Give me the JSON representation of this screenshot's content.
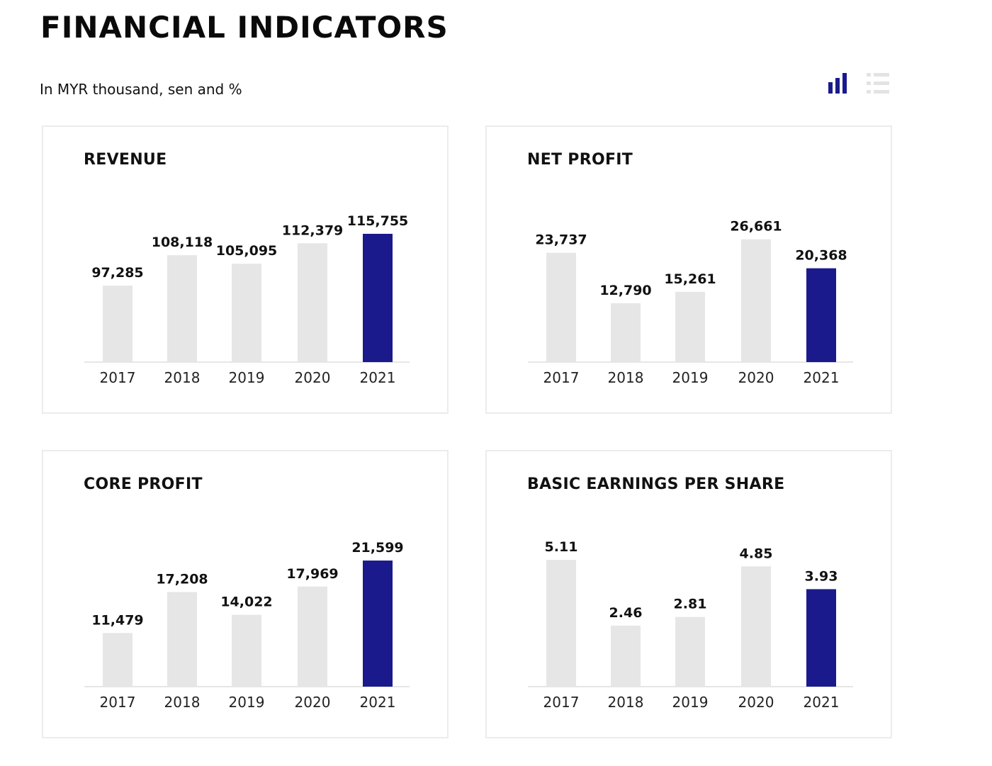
{
  "header": {
    "title": "FINANCIAL INDICATORS",
    "subtitle": "In MYR thousand, sen and %"
  },
  "view_toggle": {
    "chart_icon": "bar-chart-icon",
    "list_icon": "list-icon",
    "active": "chart"
  },
  "colors": {
    "highlight": "#1a1a8c",
    "bar": "#e6e6e6",
    "axis": "#dddddd",
    "inactive_icon": "#e3e3e3"
  },
  "chart_data": [
    {
      "type": "bar",
      "title": "REVENUE",
      "categories": [
        "2017",
        "2018",
        "2019",
        "2020",
        "2021"
      ],
      "values": [
        97285,
        108118,
        105095,
        112379,
        115755
      ],
      "labels": [
        "97,285",
        "108,118",
        "105,095",
        "112,379",
        "115,755"
      ],
      "highlight_index": 4,
      "ylim": [
        70000,
        116000
      ]
    },
    {
      "type": "bar",
      "title": "NET PROFIT",
      "categories": [
        "2017",
        "2018",
        "2019",
        "2020",
        "2021"
      ],
      "values": [
        23737,
        12790,
        15261,
        26661,
        20368
      ],
      "labels": [
        "23,737",
        "12,790",
        "15,261",
        "26,661",
        "20,368"
      ],
      "highlight_index": 4,
      "ylim": [
        0,
        28000
      ]
    },
    {
      "type": "bar",
      "title": "CORE PROFIT",
      "categories": [
        "2017",
        "2018",
        "2019",
        "2020",
        "2021"
      ],
      "values": [
        11479,
        17208,
        14022,
        17969,
        21599
      ],
      "labels": [
        "11,479",
        "17,208",
        "14,022",
        "17,969",
        "21,599"
      ],
      "highlight_index": 4,
      "ylim": [
        4000,
        22000
      ]
    },
    {
      "type": "bar",
      "title": "BASIC EARNINGS PER SHARE",
      "categories": [
        "2017",
        "2018",
        "2019",
        "2020",
        "2021"
      ],
      "values": [
        5.11,
        2.46,
        2.81,
        4.85,
        3.93
      ],
      "labels": [
        "5.11",
        "2.46",
        "2.81",
        "4.85",
        "3.93"
      ],
      "highlight_index": 4,
      "ylim": [
        0,
        5.2
      ]
    }
  ]
}
